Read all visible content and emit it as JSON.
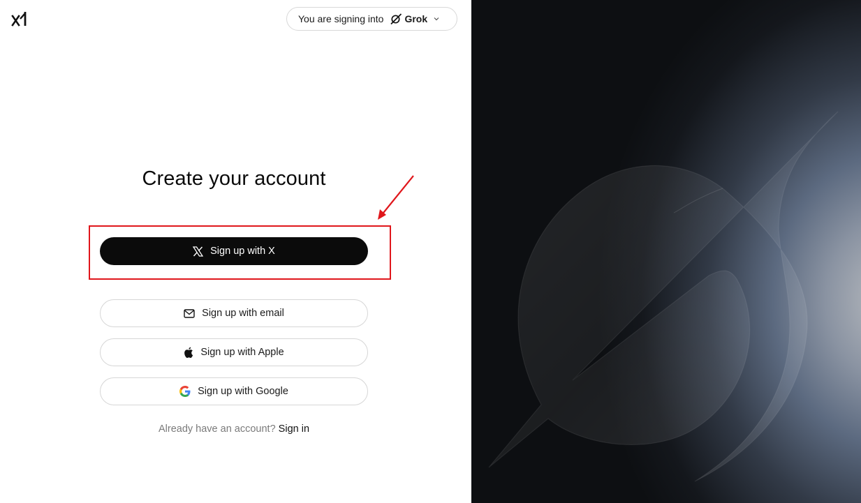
{
  "header": {
    "logo_icon": "xai-logo-icon",
    "signing_prefix": "You are signing into",
    "product_name": "Grok",
    "product_icon": "grok-logo-icon",
    "dropdown_icon": "chevron-down-icon"
  },
  "main": {
    "title": "Create your account",
    "buttons": {
      "x": {
        "label": "Sign up with X",
        "icon": "x-logo-icon"
      },
      "email": {
        "label": "Sign up with email",
        "icon": "mail-icon"
      },
      "apple": {
        "label": "Sign up with Apple",
        "icon": "apple-logo-icon"
      },
      "google": {
        "label": "Sign up with Google",
        "icon": "google-logo-icon"
      }
    },
    "already_text": "Already have an account?",
    "signin_label": "Sign in"
  },
  "annotation": {
    "highlight_color": "#e0161b"
  },
  "colors": {
    "primary_button": "#0b0b0b",
    "highlight": "#e0161b"
  }
}
